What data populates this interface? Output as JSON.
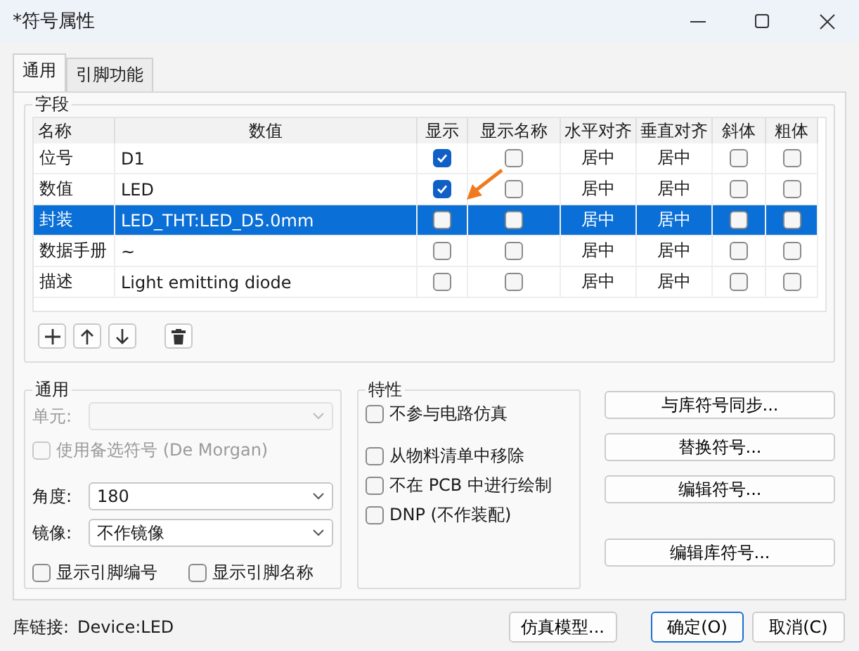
{
  "window": {
    "title": "*符号属性"
  },
  "tabs": [
    {
      "label": "通用",
      "selected": true
    },
    {
      "label": "引脚功能",
      "selected": false
    }
  ],
  "fields": {
    "title": "字段",
    "columns": [
      "名称",
      "数值",
      "显示",
      "显示名称",
      "水平对齐",
      "垂直对齐",
      "斜体",
      "粗体"
    ],
    "rows": [
      {
        "name": "位号",
        "value": "D1",
        "show": true,
        "show_name": false,
        "h_align": "居中",
        "v_align": "居中",
        "italic": false,
        "bold": false,
        "selected": false
      },
      {
        "name": "数值",
        "value": "LED",
        "show": true,
        "show_name": false,
        "h_align": "居中",
        "v_align": "居中",
        "italic": false,
        "bold": false,
        "selected": false
      },
      {
        "name": "封装",
        "value": "LED_THT:LED_D5.0mm",
        "show": false,
        "show_name": false,
        "h_align": "居中",
        "v_align": "居中",
        "italic": false,
        "bold": false,
        "selected": true
      },
      {
        "name": "数据手册",
        "value": "~",
        "show": false,
        "show_name": false,
        "h_align": "居中",
        "v_align": "居中",
        "italic": false,
        "bold": false,
        "selected": false
      },
      {
        "name": "描述",
        "value": "Light emitting diode",
        "show": false,
        "show_name": false,
        "h_align": "居中",
        "v_align": "居中",
        "italic": false,
        "bold": false,
        "selected": false
      }
    ]
  },
  "general": {
    "title": "通用",
    "unit": {
      "label": "单元:",
      "disabled": true
    },
    "de_morgan": {
      "label": "使用备选符号 (De Morgan)",
      "checked": false,
      "disabled": true
    },
    "angle": {
      "label": "角度:",
      "value": "180"
    },
    "mirror": {
      "label": "镜像:",
      "value": "不作镜像"
    },
    "show_pin_numbers": {
      "label": "显示引脚编号",
      "checked": false
    },
    "show_pin_names": {
      "label": "显示引脚名称",
      "checked": false
    }
  },
  "attributes": {
    "title": "特性",
    "options": [
      {
        "label": "不参与电路仿真",
        "checked": false
      },
      {
        "label": "从物料清单中移除",
        "checked": false
      },
      {
        "label": "不在 PCB 中进行绘制",
        "checked": false
      },
      {
        "label": "DNP (不作装配)",
        "checked": false
      }
    ]
  },
  "actions": [
    "与库符号同步...",
    "替换符号...",
    "编辑符号...",
    "编辑库符号..."
  ],
  "library_link": {
    "label": "库链接:",
    "value": "Device:LED"
  },
  "footer_buttons": [
    {
      "label": "仿真模型...",
      "default": false
    },
    {
      "label": "确定(O)",
      "default": true
    },
    {
      "label": "取消(C)",
      "default": false
    }
  ]
}
